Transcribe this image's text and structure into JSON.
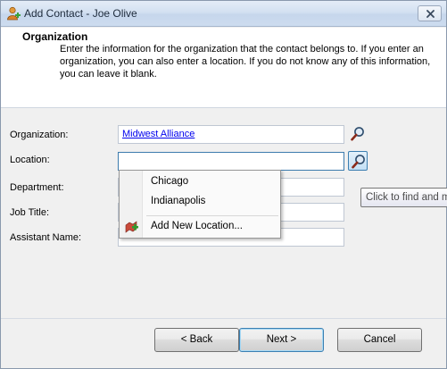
{
  "window": {
    "title": "Add Contact - Joe Olive"
  },
  "header": {
    "title": "Organization",
    "description": "Enter the information for the organization that the contact belongs to.  If you enter an organization, you can also enter a location.  If you do not know any of this information, you can leave it blank."
  },
  "form": {
    "organization": {
      "label": "Organization:",
      "value": "Midwest Alliance"
    },
    "location": {
      "label": "Location:",
      "value": ""
    },
    "department": {
      "label": "Department:",
      "value": ""
    },
    "job_title": {
      "label": "Job Title:",
      "value": ""
    },
    "assistant_name": {
      "label": "Assistant Name:",
      "value": ""
    }
  },
  "location_dropdown": {
    "items": [
      "Chicago",
      "Indianapolis"
    ],
    "add_new": "Add New Location..."
  },
  "tooltip": {
    "text": "Click to find and m"
  },
  "buttons": {
    "back": "< Back",
    "next": "Next >",
    "cancel": "Cancel"
  },
  "icons": {
    "app": "add-contact-icon",
    "lookup": "magnifier-icon",
    "add_location": "add-location-icon",
    "close": "close-icon"
  },
  "colors": {
    "link": "#0000ee",
    "focus_border": "#3d7bad"
  }
}
